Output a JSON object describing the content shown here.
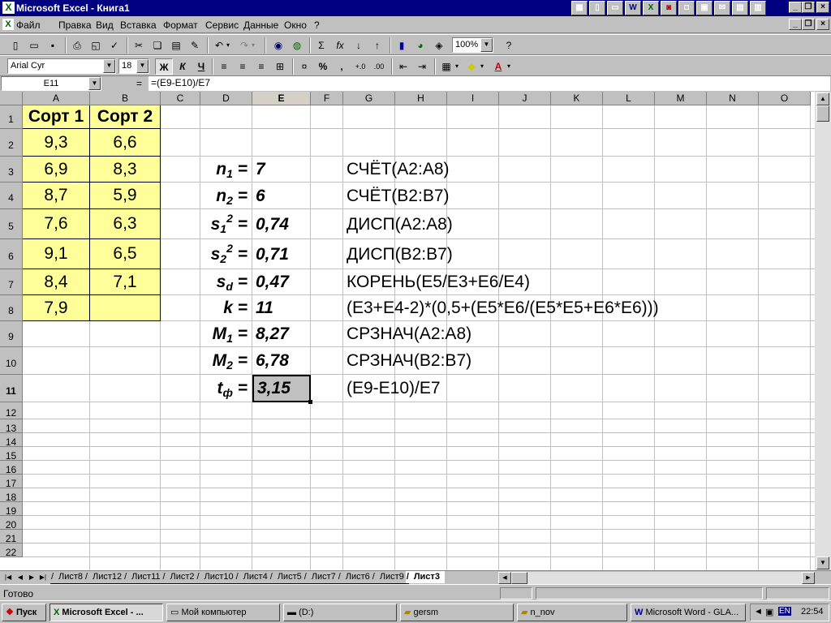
{
  "window": {
    "title": "Microsoft Excel - Книга1"
  },
  "menu": [
    "Файл",
    "Правка",
    "Вид",
    "Вставка",
    "Формат",
    "Сервис",
    "Данные",
    "Окно",
    "?"
  ],
  "format": {
    "font": "Arial Cyr",
    "size": "18",
    "zoom": "100%"
  },
  "formula_bar": {
    "name_box": "E11",
    "eq": "=",
    "formula": "=(E9-E10)/E7"
  },
  "columns": [
    "A",
    "B",
    "C",
    "D",
    "E",
    "F",
    "G",
    "H",
    "I",
    "J",
    "K",
    "L",
    "M",
    "N",
    "O"
  ],
  "rows": [
    "1",
    "2",
    "3",
    "4",
    "5",
    "6",
    "7",
    "8",
    "9",
    "10",
    "11",
    "12",
    "13",
    "14",
    "15",
    "16",
    "17",
    "18",
    "19",
    "20",
    "21",
    "22"
  ],
  "table": {
    "headers": [
      "Сорт 1",
      "Сорт 2"
    ],
    "sort1": [
      "9,3",
      "6,9",
      "8,7",
      "7,6",
      "9,1",
      "8,4",
      "7,9"
    ],
    "sort2": [
      "6,6",
      "8,3",
      "5,9",
      "6,3",
      "6,5",
      "7,1",
      ""
    ]
  },
  "calc": [
    {
      "label": "n",
      "sub": "1",
      "sup": "",
      "value": "7",
      "formula": "СЧЁТ(A2:A8)"
    },
    {
      "label": "n",
      "sub": "2",
      "sup": "",
      "value": "6",
      "formula": "СЧЁТ(B2:B7)"
    },
    {
      "label": "s",
      "sub": "1",
      "sup": "2",
      "value": "0,74",
      "formula": "ДИСП(A2:A8)"
    },
    {
      "label": "s",
      "sub": "2",
      "sup": "2",
      "value": "0,71",
      "formula": "ДИСП(B2:B7)"
    },
    {
      "label": "s",
      "sub": "d",
      "sup": "",
      "value": "0,47",
      "formula": "КОРЕНЬ(E5/E3+E6/E4)"
    },
    {
      "label": "k",
      "sub": "",
      "sup": "",
      "value": "11",
      "formula": "(E3+E4-2)*(0,5+(E5*E6/(E5*E5+E6*E6)))"
    },
    {
      "label": "M",
      "sub": "1",
      "sup": "",
      "value": "8,27",
      "formula": "СРЗНАЧ(A2:A8)"
    },
    {
      "label": "M",
      "sub": "2",
      "sup": "",
      "value": "6,78",
      "formula": "СРЗНАЧ(B2:B7)"
    },
    {
      "label": "t",
      "sub": "ф",
      "sup": "",
      "value": "3,15",
      "formula": "(E9-E10)/E7"
    }
  ],
  "sheets": [
    "Лист8",
    "Лист12",
    "Лист11",
    "Лист2",
    "Лист10",
    "Лист4",
    "Лист5",
    "Лист7",
    "Лист6",
    "Лист9",
    "Лист3"
  ],
  "active_sheet": "Лист3",
  "status": "Готово",
  "taskbar": {
    "start": "Пуск",
    "buttons": [
      "Microsoft Excel - ...",
      "Мой компьютер",
      "(D:)",
      "gersm",
      "n_nov",
      "Microsoft Word - GLA..."
    ],
    "lang": "EN",
    "clock": "22:54"
  }
}
